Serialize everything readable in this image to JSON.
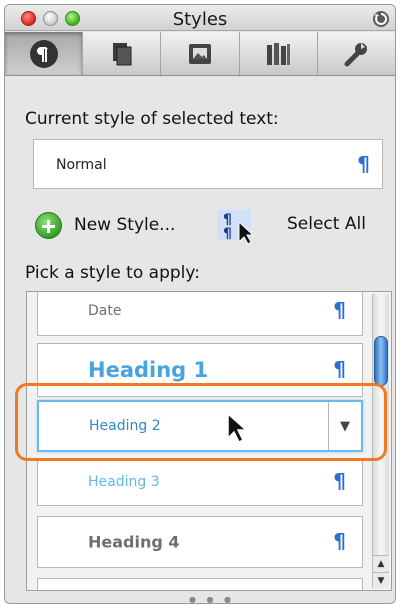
{
  "window": {
    "title": "Styles"
  },
  "toolbar": {
    "tabs": [
      {
        "name": "paragraph-styles-tab",
        "icon": "paragraph-mark-icon",
        "active": true
      },
      {
        "name": "pages-tab",
        "icon": "pages-icon",
        "active": false
      },
      {
        "name": "media-tab",
        "icon": "media-icon",
        "active": false
      },
      {
        "name": "library-tab",
        "icon": "books-icon",
        "active": false
      },
      {
        "name": "tools-tab",
        "icon": "wrench-icon",
        "active": false
      }
    ]
  },
  "current_style": {
    "heading": "Current style of selected text:",
    "value": "Normal",
    "mark": "¶"
  },
  "actions": {
    "new_style_label": "New Style...",
    "select_all_label": "Select All"
  },
  "pick_style": {
    "heading": "Pick a style to apply:",
    "items": [
      {
        "label": "Date",
        "mark": "¶",
        "selected": false
      },
      {
        "label": "Heading 1",
        "mark": "¶",
        "selected": false
      },
      {
        "label": "Heading 2",
        "dropdown": "▼",
        "selected": true
      },
      {
        "label": "Heading 3",
        "mark": "¶",
        "selected": false
      },
      {
        "label": "Heading 4",
        "mark": "¶",
        "selected": false
      }
    ]
  },
  "scrollbar": {
    "up_arrow": "▲",
    "down_arrow": "▼"
  },
  "colors": {
    "accent_blue": "#2a6fd1",
    "highlight_orange": "#ef7a25",
    "heading_blue": "#4aa3dc"
  }
}
